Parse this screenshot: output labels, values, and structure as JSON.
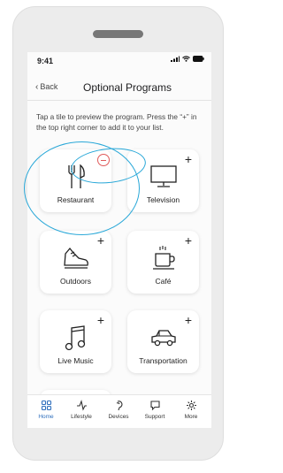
{
  "status_bar": {
    "time": "9:41"
  },
  "nav": {
    "back_label": "Back",
    "title": "Optional Programs"
  },
  "instructions": "Tap a tile to preview the program. Press the “+” in the top right corner to add it to your list.",
  "tiles": [
    {
      "label": "Restaurant",
      "icon": "fork-knife-icon",
      "added": true
    },
    {
      "label": "Television",
      "icon": "television-icon",
      "added": false
    },
    {
      "label": "Outdoors",
      "icon": "sneaker-icon",
      "added": false
    },
    {
      "label": "Café",
      "icon": "coffee-cup-icon",
      "added": false
    },
    {
      "label": "Live Music",
      "icon": "music-note-icon",
      "added": false
    },
    {
      "label": "Transportation",
      "icon": "car-icon",
      "added": false
    }
  ],
  "plus_symbol": "+",
  "tab_bar": {
    "items": [
      {
        "label": "Home",
        "icon": "home-grid-icon",
        "active": true
      },
      {
        "label": "Lifestyle",
        "icon": "activity-icon",
        "active": false
      },
      {
        "label": "Devices",
        "icon": "hearing-aid-icon",
        "active": false
      },
      {
        "label": "Support",
        "icon": "chat-bubble-icon",
        "active": false
      },
      {
        "label": "More",
        "icon": "gear-icon",
        "active": false
      }
    ]
  },
  "colors": {
    "accent": "#2f6fbd",
    "remove": "#e05a5a",
    "annotation": "#2aa8d8"
  }
}
